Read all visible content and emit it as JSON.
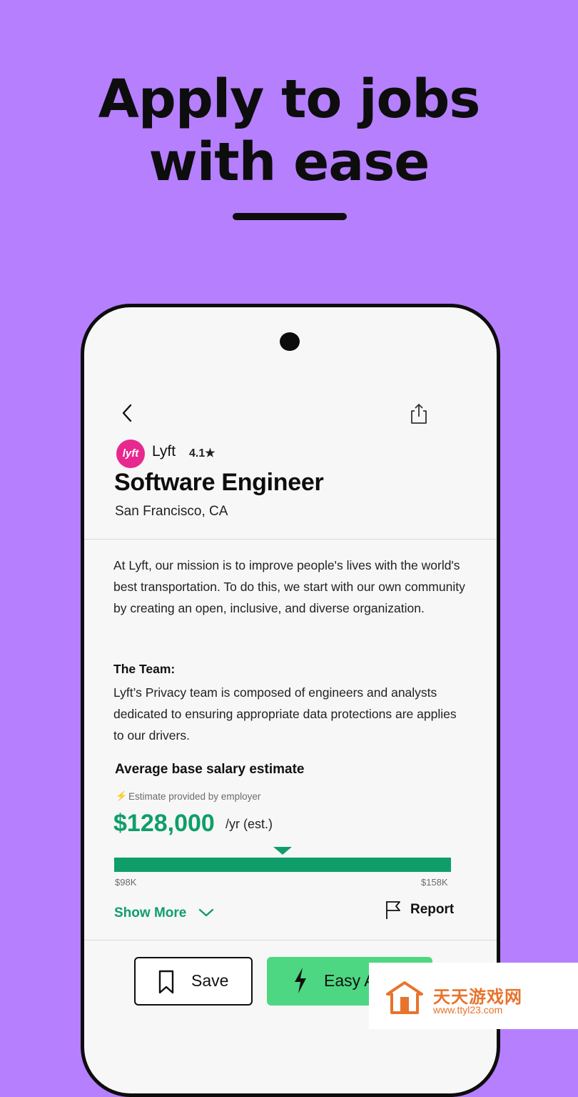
{
  "promo": {
    "headline_line1": "Apply to jobs",
    "headline_line2": "with ease"
  },
  "job": {
    "company": "Lyft",
    "logo_text": "lyft",
    "rating": "4.1★",
    "title": "Software Engineer",
    "location": "San Francisco, CA",
    "description": "At Lyft, our mission is to improve people's lives with the world's best transportation. To do this, we start with our own community by creating an open, inclusive, and diverse organization.",
    "team_heading": "The Team:",
    "team_description": "Lyft’s Privacy team is composed of engineers and analysts dedicated to ensuring appropriate data protections are applies to our drivers."
  },
  "salary": {
    "heading": "Average base salary estimate",
    "note": "Estimate provided by employer",
    "amount": "$128,000",
    "unit": "/yr (est.)",
    "min_label": "$98K",
    "max_label": "$158K",
    "marker_fraction": 0.5
  },
  "actions": {
    "show_more": "Show More",
    "report": "Report",
    "save": "Save",
    "apply": "Easy A"
  },
  "watermark": {
    "title": "天天游戏网",
    "url": "www.ttyl23.com"
  },
  "colors": {
    "background": "#B57FFE",
    "accent_green": "#0f9e6a",
    "apply_green": "#4ED783",
    "lyft_pink": "#E8288F"
  },
  "icons": [
    "back-icon",
    "share-icon",
    "bolt-icon",
    "chevron-down-icon",
    "flag-icon",
    "bookmark-icon"
  ]
}
